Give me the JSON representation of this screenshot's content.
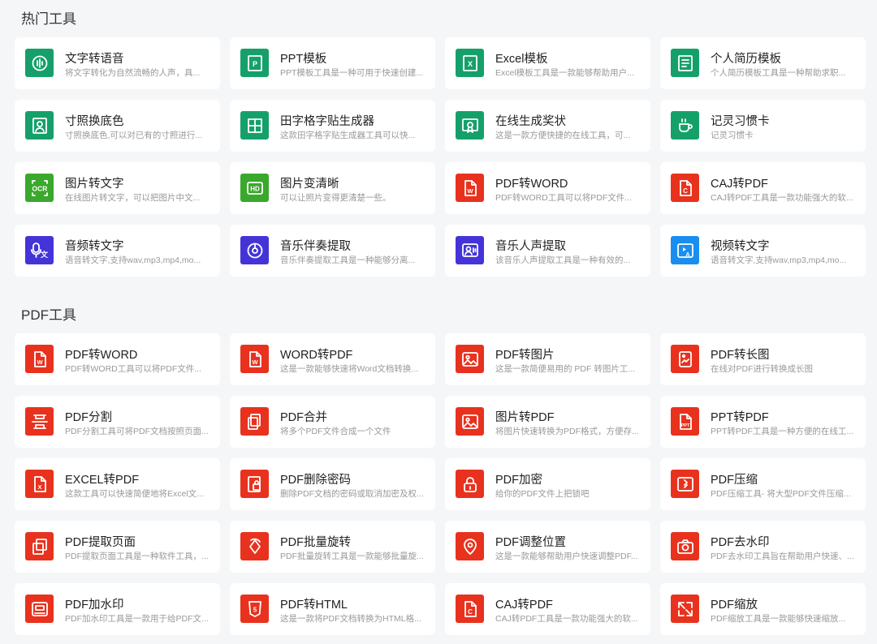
{
  "sections": [
    {
      "title": "热门工具",
      "items": [
        {
          "title": "文字转语音",
          "desc": "将文字转化为自然流畅的人声，具...",
          "icon": "voice-wave-icon",
          "color": "#15a06a"
        },
        {
          "title": "PPT模板",
          "desc": "PPT模板工具是一种可用于快速创建...",
          "icon": "ppt-icon",
          "color": "#15a06a"
        },
        {
          "title": "Excel模板",
          "desc": "Excel模板工具是一款能够帮助用户...",
          "icon": "excel-icon",
          "color": "#15a06a"
        },
        {
          "title": "个人简历模板",
          "desc": "个人简历模板工具是一种帮助求职...",
          "icon": "resume-icon",
          "color": "#15a06a"
        },
        {
          "title": "寸照换底色",
          "desc": "寸照换底色,可以对已有的寸照进行...",
          "icon": "portrait-icon",
          "color": "#15a06a"
        },
        {
          "title": "田字格字贴生成器",
          "desc": "这款田字格字贴生成器工具可以快...",
          "icon": "grid-icon",
          "color": "#15a06a"
        },
        {
          "title": "在线生成奖状",
          "desc": "这是一款方便快捷的在线工具，可...",
          "icon": "certificate-icon",
          "color": "#15a06a"
        },
        {
          "title": "记灵习惯卡",
          "desc": "记灵习惯卡",
          "icon": "coffee-cup-icon",
          "color": "#15a06a"
        },
        {
          "title": "图片转文字",
          "desc": "在线图片转文字，可以把图片中文...",
          "icon": "ocr-icon",
          "color": "#3aa82c"
        },
        {
          "title": "图片变清晰",
          "desc": "可以让照片变得更清楚一些。",
          "icon": "hd-icon",
          "color": "#3aa82c"
        },
        {
          "title": "PDF转WORD",
          "desc": "PDF转WORD工具可以将PDF文件...",
          "icon": "word-doc-icon",
          "color": "#e8321e"
        },
        {
          "title": "CAJ转PDF",
          "desc": "CAJ转PDF工具是一款功能强大的软...",
          "icon": "caj-icon",
          "color": "#e8321e"
        },
        {
          "title": "音频转文字",
          "desc": "语音转文字,支持wav,mp3,mp4,mo...",
          "icon": "audio-text-icon",
          "color": "#4434d8"
        },
        {
          "title": "音乐伴奏提取",
          "desc": "音乐伴奏提取工具是一种能够分离...",
          "icon": "music-disc-icon",
          "color": "#4434d8"
        },
        {
          "title": "音乐人声提取",
          "desc": "该音乐人声提取工具是一种有效的...",
          "icon": "vocal-icon",
          "color": "#4434d8"
        },
        {
          "title": "视频转文字",
          "desc": "语音转文字,支持wav,mp3,mp4,mo...",
          "icon": "video-text-icon",
          "color": "#1a8ef0"
        }
      ]
    },
    {
      "title": "PDF工具",
      "items": [
        {
          "title": "PDF转WORD",
          "desc": "PDF转WORD工具可以将PDF文件...",
          "icon": "word-doc-icon",
          "color": "#e8321e"
        },
        {
          "title": "WORD转PDF",
          "desc": "这是一款能够快速将Word文档转换...",
          "icon": "word-to-pdf-icon",
          "color": "#e8321e"
        },
        {
          "title": "PDF转图片",
          "desc": "这是一款简便易用的 PDF 转图片工...",
          "icon": "image-icon",
          "color": "#e8321e"
        },
        {
          "title": "PDF转长图",
          "desc": "在线对PDF进行转换成长图",
          "icon": "long-image-icon",
          "color": "#e8321e"
        },
        {
          "title": "PDF分割",
          "desc": "PDF分割工具可将PDF文档按照页面...",
          "icon": "split-icon",
          "color": "#e8321e"
        },
        {
          "title": "PDF合并",
          "desc": "将多个PDF文件合成一个文件",
          "icon": "merge-icon",
          "color": "#e8321e"
        },
        {
          "title": "图片转PDF",
          "desc": "将图片快速转换为PDF格式，方便存...",
          "icon": "image-icon",
          "color": "#e8321e"
        },
        {
          "title": "PPT转PDF",
          "desc": "PPT转PDF工具是一种方便的在线工...",
          "icon": "ppt-doc-icon",
          "color": "#e8321e"
        },
        {
          "title": "EXCEL转PDF",
          "desc": "这款工具可以快速简便地将Excel文...",
          "icon": "excel-doc-icon",
          "color": "#e8321e"
        },
        {
          "title": "PDF删除密码",
          "desc": "删除PDF文档的密码或取消加密及权...",
          "icon": "unlock-doc-icon",
          "color": "#e8321e"
        },
        {
          "title": "PDF加密",
          "desc": "给你的PDF文件上把锁吧",
          "icon": "lock-icon",
          "color": "#e8321e"
        },
        {
          "title": "PDF压缩",
          "desc": "PDF压缩工具- 将大型PDF文件压缩...",
          "icon": "compress-icon",
          "color": "#e8321e"
        },
        {
          "title": "PDF提取页面",
          "desc": "PDF提取页面工具是一种软件工具，...",
          "icon": "extract-pages-icon",
          "color": "#e8321e"
        },
        {
          "title": "PDF批量旋转",
          "desc": "PDF批量旋转工具是一款能够批量旋...",
          "icon": "rotate-icon",
          "color": "#e8321e"
        },
        {
          "title": "PDF调整位置",
          "desc": "这是一款能够帮助用户快速调整PDF...",
          "icon": "location-icon",
          "color": "#e8321e"
        },
        {
          "title": "PDF去水印",
          "desc": "PDF去水印工具旨在帮助用户快速、...",
          "icon": "camera-icon",
          "color": "#e8321e"
        },
        {
          "title": "PDF加水印",
          "desc": "PDF加水印工具是一款用于给PDF文...",
          "icon": "watermark-icon",
          "color": "#e8321e"
        },
        {
          "title": "PDF转HTML",
          "desc": "这是一款将PDF文档转换为HTML格...",
          "icon": "html5-icon",
          "color": "#e8321e"
        },
        {
          "title": "CAJ转PDF",
          "desc": "CAJ转PDF工具是一款功能强大的软...",
          "icon": "caj-icon",
          "color": "#e8321e"
        },
        {
          "title": "PDF缩放",
          "desc": "PDF缩放工具是一款能够快速缩放...",
          "icon": "zoom-icon",
          "color": "#e8321e"
        }
      ]
    }
  ]
}
